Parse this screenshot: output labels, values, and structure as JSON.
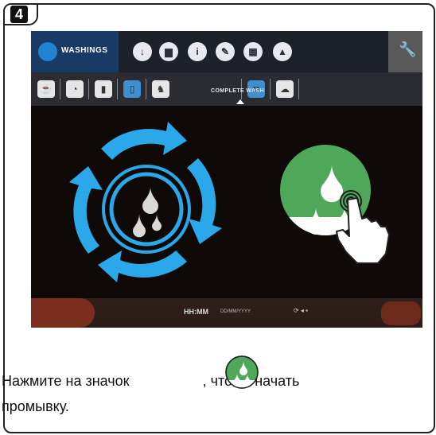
{
  "step": {
    "number": "4"
  },
  "topbar": {
    "active_tab": "WASHINGS",
    "active_tab_icon": "water-drop-icon",
    "tab_icons": [
      "clock-icon",
      "folder-icon",
      "info-icon",
      "edit-icon",
      "calendar-icon",
      "stack-icon"
    ],
    "settings_icon": "wrench-icon"
  },
  "washes": {
    "items": [
      "rinse-icon",
      "cup-icon",
      "milk-icon",
      "glass-icon",
      "complete-wash-icon",
      "cup-blue-icon",
      "descale-icon"
    ],
    "selected_label": "COMPLETE WASH"
  },
  "main": {
    "cycle_icon": "wash-cycle-icon",
    "start_button_icon": "start-wash-icon",
    "hand_icon": "hand-pointer-icon"
  },
  "status_bar": {
    "time": "HH:MM",
    "date": "DD/MM/YYYY",
    "status": "⟳ ◂ ▪"
  },
  "caption": {
    "line1_before": "Нажмите на значок",
    "line1_after": ", чтобы начать",
    "line2": "промывку."
  },
  "colors": {
    "accent_blue": "#2aa8ea",
    "green": "#4fa85a",
    "topbar": "#1c2029",
    "active_tab": "#1a3a66"
  }
}
